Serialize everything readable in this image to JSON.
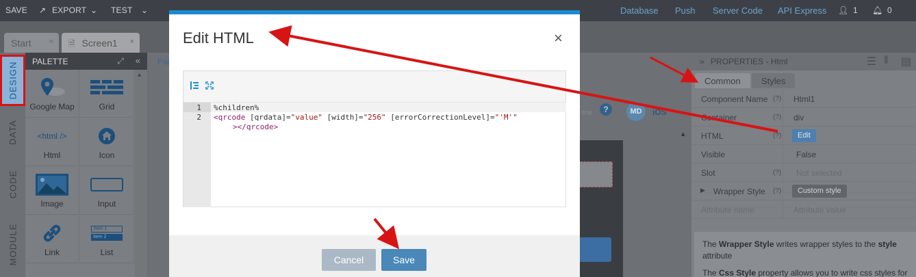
{
  "topbar": {
    "save": "SAVE",
    "export": "EXPORT",
    "test": "TEST",
    "links": [
      "Database",
      "Push",
      "Server Code",
      "API Express"
    ],
    "users_count": "1",
    "notif_count": "0"
  },
  "tabs": [
    {
      "label": "Start"
    },
    {
      "label": "Screen1"
    }
  ],
  "vtabs": [
    "DESIGN",
    "DATA",
    "CODE",
    "MODULE"
  ],
  "palette": {
    "title": "PALETTE",
    "items": [
      {
        "label": "Google Map",
        "icon": "map-pin-icon"
      },
      {
        "label": "Grid",
        "icon": "grid-icon"
      },
      {
        "label": "Html",
        "icon": "html-icon",
        "glyph": "<html />"
      },
      {
        "label": "Icon",
        "icon": "home-icon"
      },
      {
        "label": "Image",
        "icon": "image-icon"
      },
      {
        "label": "Input",
        "icon": "input-icon"
      },
      {
        "label": "Link",
        "icon": "link-icon"
      },
      {
        "label": "List",
        "icon": "list-icon",
        "items": [
          "Item 1",
          "Item 2"
        ]
      }
    ]
  },
  "canvas": {
    "page_label": "Pag",
    "faint_text": "me",
    "md_badge": "MD",
    "ios_label": "iOS"
  },
  "properties": {
    "title": "PROPERTIES - Html",
    "tabs": [
      "Common",
      "Styles"
    ],
    "rows": [
      {
        "key": "Component Name",
        "help": "(?)",
        "value": "Html1"
      },
      {
        "key": "Container",
        "help": "(?)",
        "value": "div"
      },
      {
        "key": "HTML",
        "help": "(?)",
        "button": "Edit"
      },
      {
        "key": "Visible",
        "help": "",
        "value": "False"
      },
      {
        "key": "Slot",
        "help": "(?)",
        "value": "Not selected"
      },
      {
        "key": "Wrapper Style",
        "help": "(?)",
        "button": "Custom style"
      },
      {
        "key": "Attribute name",
        "help": "",
        "value": "Attribute value"
      }
    ],
    "info_line1_pre": "The ",
    "info_line1_bold": "Wrapper Style",
    "info_line1_mid": " writes wrapper styles to the ",
    "info_line1_bold2": "style",
    "info_line2": "attribute",
    "info_line3_pre": "The ",
    "info_line3_bold": "Css Style",
    "info_line3_post": " property allows you to write css styles for"
  },
  "modal": {
    "title": "Edit HTML",
    "close": "×",
    "toolbar": [
      "format-icon",
      "fullscreen-icon"
    ],
    "line_numbers": [
      "1",
      "2"
    ],
    "code_line1": "%children%",
    "code_line2_tag": "<qrcode",
    "code_line2_a1": " [qrdata]=",
    "code_line2_s1": "\"value\"",
    "code_line2_a2": " [width]=",
    "code_line2_s2": "\"256\"",
    "code_line2_a3": " [errorCorrectionLevel]=",
    "code_line2_s3": "\"'M'\"",
    "code_line3": "></qrcode>",
    "cancel": "Cancel",
    "save": "Save"
  },
  "colors": {
    "accent": "#1b8bcf",
    "save_button": "#4a88ba",
    "cancel_button": "#aab9c5",
    "arrow": "#d71414"
  }
}
